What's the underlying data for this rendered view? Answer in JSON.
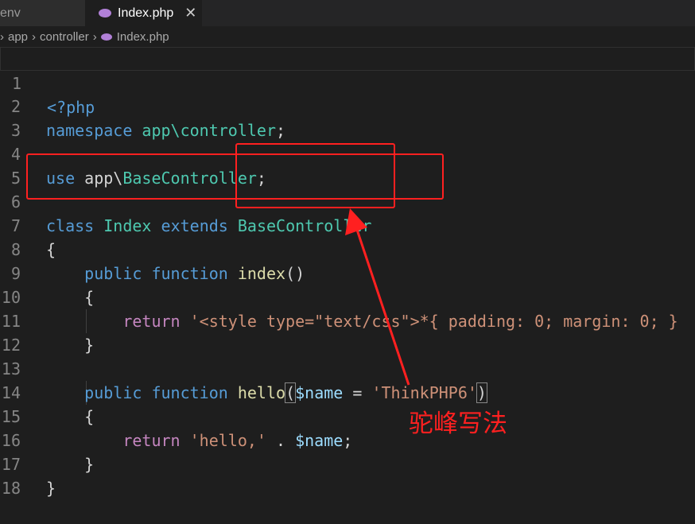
{
  "tabs": [
    {
      "label": "env",
      "active": false
    },
    {
      "label": "Index.php",
      "active": true,
      "close_glyph": "✕"
    }
  ],
  "breadcrumb": {
    "items": [
      "app",
      "controller",
      "Index.php"
    ],
    "separator": "›"
  },
  "code": {
    "line_numbers": [
      "1",
      "2",
      "3",
      "4",
      "5",
      "6",
      "7",
      "8",
      "9",
      "10",
      "11",
      "12",
      "13",
      "14",
      "15",
      "16",
      "17",
      "18"
    ],
    "lines": {
      "l1": "<?php",
      "l2_kw": "namespace",
      "l2_ns": "app\\controller",
      "l2_end": ";",
      "l4_kw": "use",
      "l4_ns1": "app\\",
      "l4_ns2": "BaseController",
      "l4_end": ";",
      "l6_kw1": "class",
      "l6_cls": "Index",
      "l6_kw2": "extends",
      "l6_base": "BaseController",
      "l7": "{",
      "l8_kw1": "public",
      "l8_kw2": "function",
      "l8_fn": "index",
      "l8_paren": "()",
      "l9": "{",
      "l10_kw": "return",
      "l10_str": "'<style type=\"text/css\">*{ padding: 0; margin: 0; }",
      "l11": "}",
      "l13_kw1": "public",
      "l13_kw2": "function",
      "l13_fn": "hello",
      "l13_open": "(",
      "l13_var": "$name",
      "l13_eq": " = ",
      "l13_str": "'ThinkPHP6'",
      "l13_close": ")",
      "l14": "{",
      "l15_kw": "return",
      "l15_str": "'hello,'",
      "l15_dot": " . ",
      "l15_var": "$name",
      "l15_end": ";",
      "l16": "}",
      "l17": "}"
    }
  },
  "annotation": {
    "label": "驼峰写法",
    "color": "#ff2020"
  },
  "colors": {
    "keyword": "#569cd6",
    "control": "#c586c0",
    "class": "#4ec9b0",
    "function": "#dcdcaa",
    "string": "#ce9178",
    "variable": "#9cdcfe"
  },
  "icons": {
    "file_icon": "php-elephant-icon",
    "close_icon": "close-icon",
    "breadcrumb_separator": "chevron-right-icon"
  }
}
